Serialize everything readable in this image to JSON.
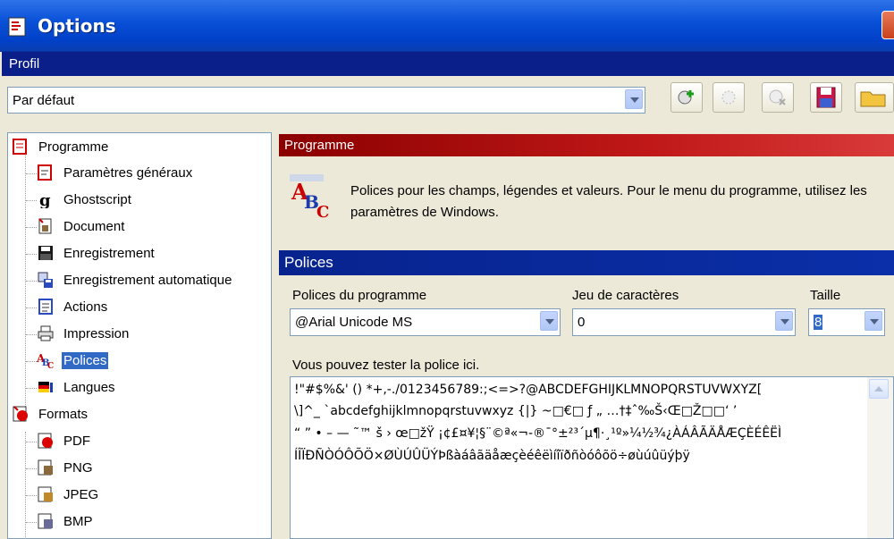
{
  "window": {
    "title": "Options"
  },
  "profile": {
    "header": "Profil",
    "selected": "Par défaut",
    "toolbar": [
      {
        "name": "add-profile",
        "icon": "add-profile-icon"
      },
      {
        "name": "rename-profile",
        "icon": "rename-profile-icon"
      },
      {
        "name": "delete-profile",
        "icon": "delete-profile-icon"
      },
      {
        "name": "save-profile",
        "icon": "save-icon"
      },
      {
        "name": "open-profile",
        "icon": "folder-icon"
      }
    ]
  },
  "tree": {
    "programme": {
      "label": "Programme",
      "items": [
        {
          "label": "Paramètres généraux",
          "icon": "general-settings-icon"
        },
        {
          "label": "Ghostscript",
          "icon": "ghostscript-icon"
        },
        {
          "label": "Document",
          "icon": "document-icon"
        },
        {
          "label": "Enregistrement",
          "icon": "save-icon"
        },
        {
          "label": "Enregistrement automatique",
          "icon": "autosave-icon"
        },
        {
          "label": "Actions",
          "icon": "actions-icon"
        },
        {
          "label": "Impression",
          "icon": "printer-icon"
        },
        {
          "label": "Polices",
          "icon": "fonts-icon"
        },
        {
          "label": "Langues",
          "icon": "flag-icon"
        }
      ]
    },
    "formats": {
      "label": "Formats",
      "items": [
        {
          "label": "PDF",
          "icon": "pdf-icon"
        },
        {
          "label": "PNG",
          "icon": "png-icon"
        },
        {
          "label": "JPEG",
          "icon": "jpeg-icon"
        },
        {
          "label": "BMP",
          "icon": "bmp-icon"
        }
      ]
    },
    "selected": "Polices"
  },
  "panel": {
    "section_title": "Programme",
    "info": "Polices pour les champs, légendes et valeurs. Pour le menu du programme, utilisez les paramètres de Windows.",
    "group_title": "Polices",
    "font_label": "Polices du programme",
    "font_value": "@Arial Unicode MS",
    "charset_label": "Jeu de caractères",
    "charset_value": "0",
    "size_label": "Taille",
    "size_value": "8",
    "test_label": "Vous pouvez tester la police ici.",
    "test_lines": [
      "!\"#$%&' () *+,-./0123456789:;<=>?@ABCDEFGHIJKLMNOPQRSTUVWXYZ[",
      "\\]^_ `abcdefghijklmnopqrstuvwxyz {|} ~□€□ ƒ „ …†‡ˆ‰Š‹Œ□Ž□□‘ ’",
      "“ ” • – — ˜™ š › œ□žŸ ¡¢£¤¥¦§¨©ª«¬-®¯°±²³´µ¶·¸¹º»¼½¾¿ÀÁÂÃÄÅÆÇÈÉÊËÌ",
      "ÍÎÏÐÑÒÓÔÕÖ×ØÙÚÛÜÝÞßàáâãäåæçèéêëìíîïðñòóôõö÷øùúûüýþÿ"
    ]
  },
  "colors": {
    "titlebar": "#0a52d9",
    "profile_bar": "#0b1f8a",
    "section_bar": "#b01010",
    "group_bar": "#08238e",
    "selection": "#316ac5"
  }
}
